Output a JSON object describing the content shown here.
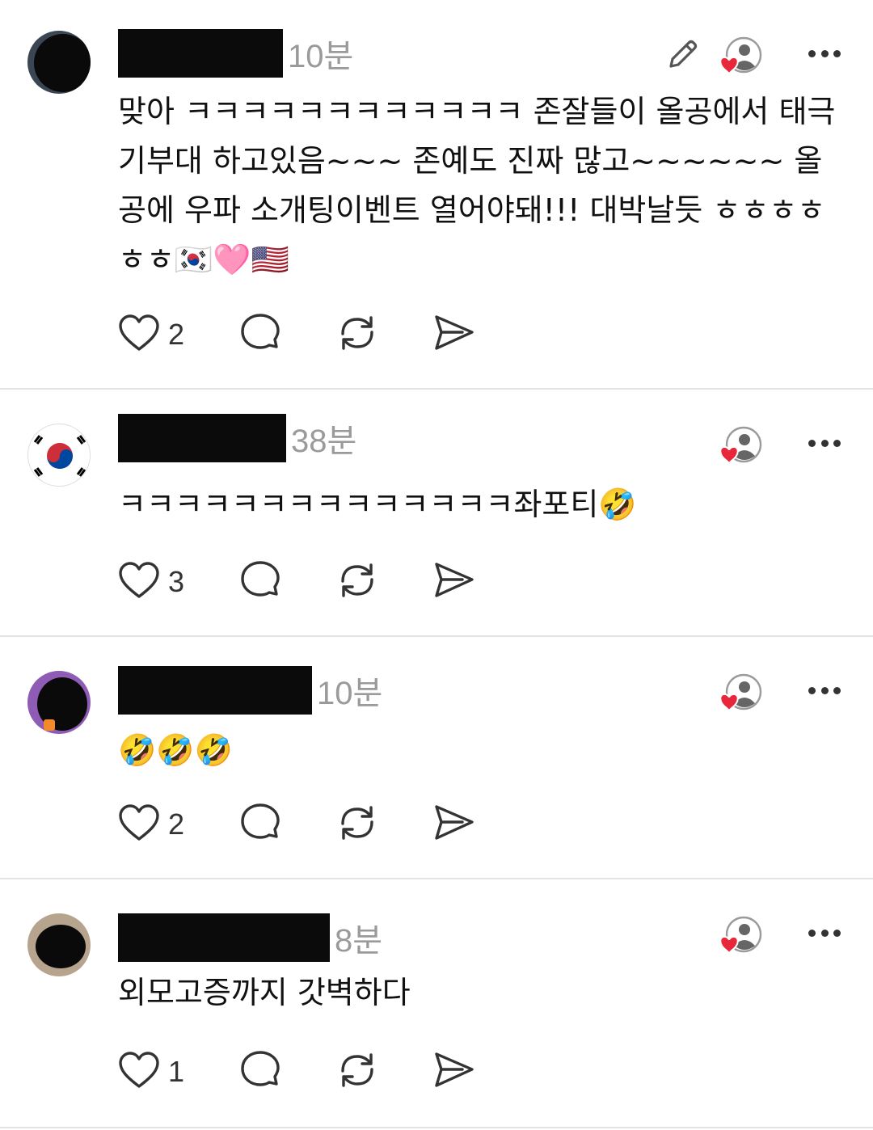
{
  "posts": [
    {
      "username": "",
      "time": "10분",
      "text": "맞아 ㅋㅋㅋㅋㅋㅋㅋㅋㅋㅋㅋㅋ 존잘들이 올공에서 태극기부대 하고있음~~~ 존예도 진짜 많고~~~~~~ 올공에 우파 소개팅이벤트 열어야돼!!! 대박날듯 ㅎㅎㅎㅎㅎㅎ🇰🇷🩷🇺🇸",
      "likes": "2",
      "has_edit": true
    },
    {
      "username": "",
      "time": "38분",
      "text": "ㅋㅋㅋㅋㅋㅋㅋㅋㅋㅋㅋㅋㅋㅋ좌포티🤣",
      "likes": "3",
      "has_edit": false
    },
    {
      "username": "",
      "time": "10분",
      "text": "🤣🤣🤣",
      "likes": "2",
      "has_edit": false
    },
    {
      "username": "",
      "time": "8분",
      "text": "외모고증까지 갓벽하다",
      "likes": "1",
      "has_edit": false
    }
  ],
  "icons": {
    "edit": "pencil-icon",
    "liked_by": "liked-by-author-icon",
    "more": "more-options-icon",
    "like": "heart-icon",
    "reply": "comment-icon",
    "repost": "repost-icon",
    "share": "send-icon"
  },
  "colors": {
    "heart_red": "#e8283a",
    "text": "#111111",
    "muted": "#9a9a9a",
    "divider": "#e3e3e3",
    "redaction": "#0b0b0b"
  }
}
